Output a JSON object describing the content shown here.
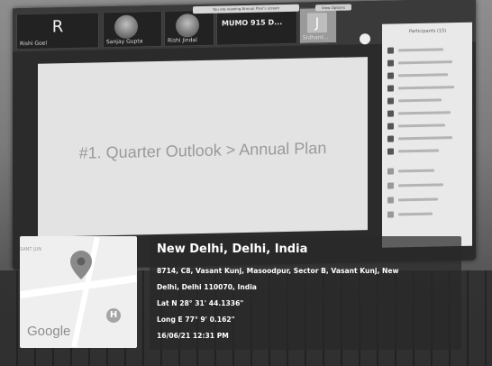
{
  "meeting": {
    "participants_tiles": [
      {
        "letter": "R",
        "name": "Rishi Goel"
      },
      {
        "name": "Sanjay Gupta"
      },
      {
        "name": "Rishi Jindal"
      },
      {
        "bold": "MUMO 915 D...",
        "name": ""
      },
      {
        "letter": "J",
        "name": "Sidhant..."
      }
    ],
    "toast_text": "You are viewing Annual Plan's screen",
    "view_options": "View Options",
    "participants_panel_title": "Participants (15)"
  },
  "slide": {
    "title": "#1. Quarter Outlook > Annual Plan"
  },
  "location": {
    "title": "New Delhi, Delhi, India",
    "address_line1": "8714, C8, Vasant Kunj, Masoodpur, Sector B, Vasant Kunj, New",
    "address_line2": "Delhi, Delhi 110070, India",
    "lat": "Lat N 28° 31' 44.1336\"",
    "long": "Long E 77° 9' 0.162\"",
    "datetime": "16/06/21 12:31 PM"
  },
  "map": {
    "logo": "Google",
    "area_label": "SANT JUN",
    "marker_letter": "H"
  },
  "colors": {
    "overlay_bg": "#2a2a2a",
    "text": "#ffffff",
    "slide_bg": "#e3e3e3"
  }
}
